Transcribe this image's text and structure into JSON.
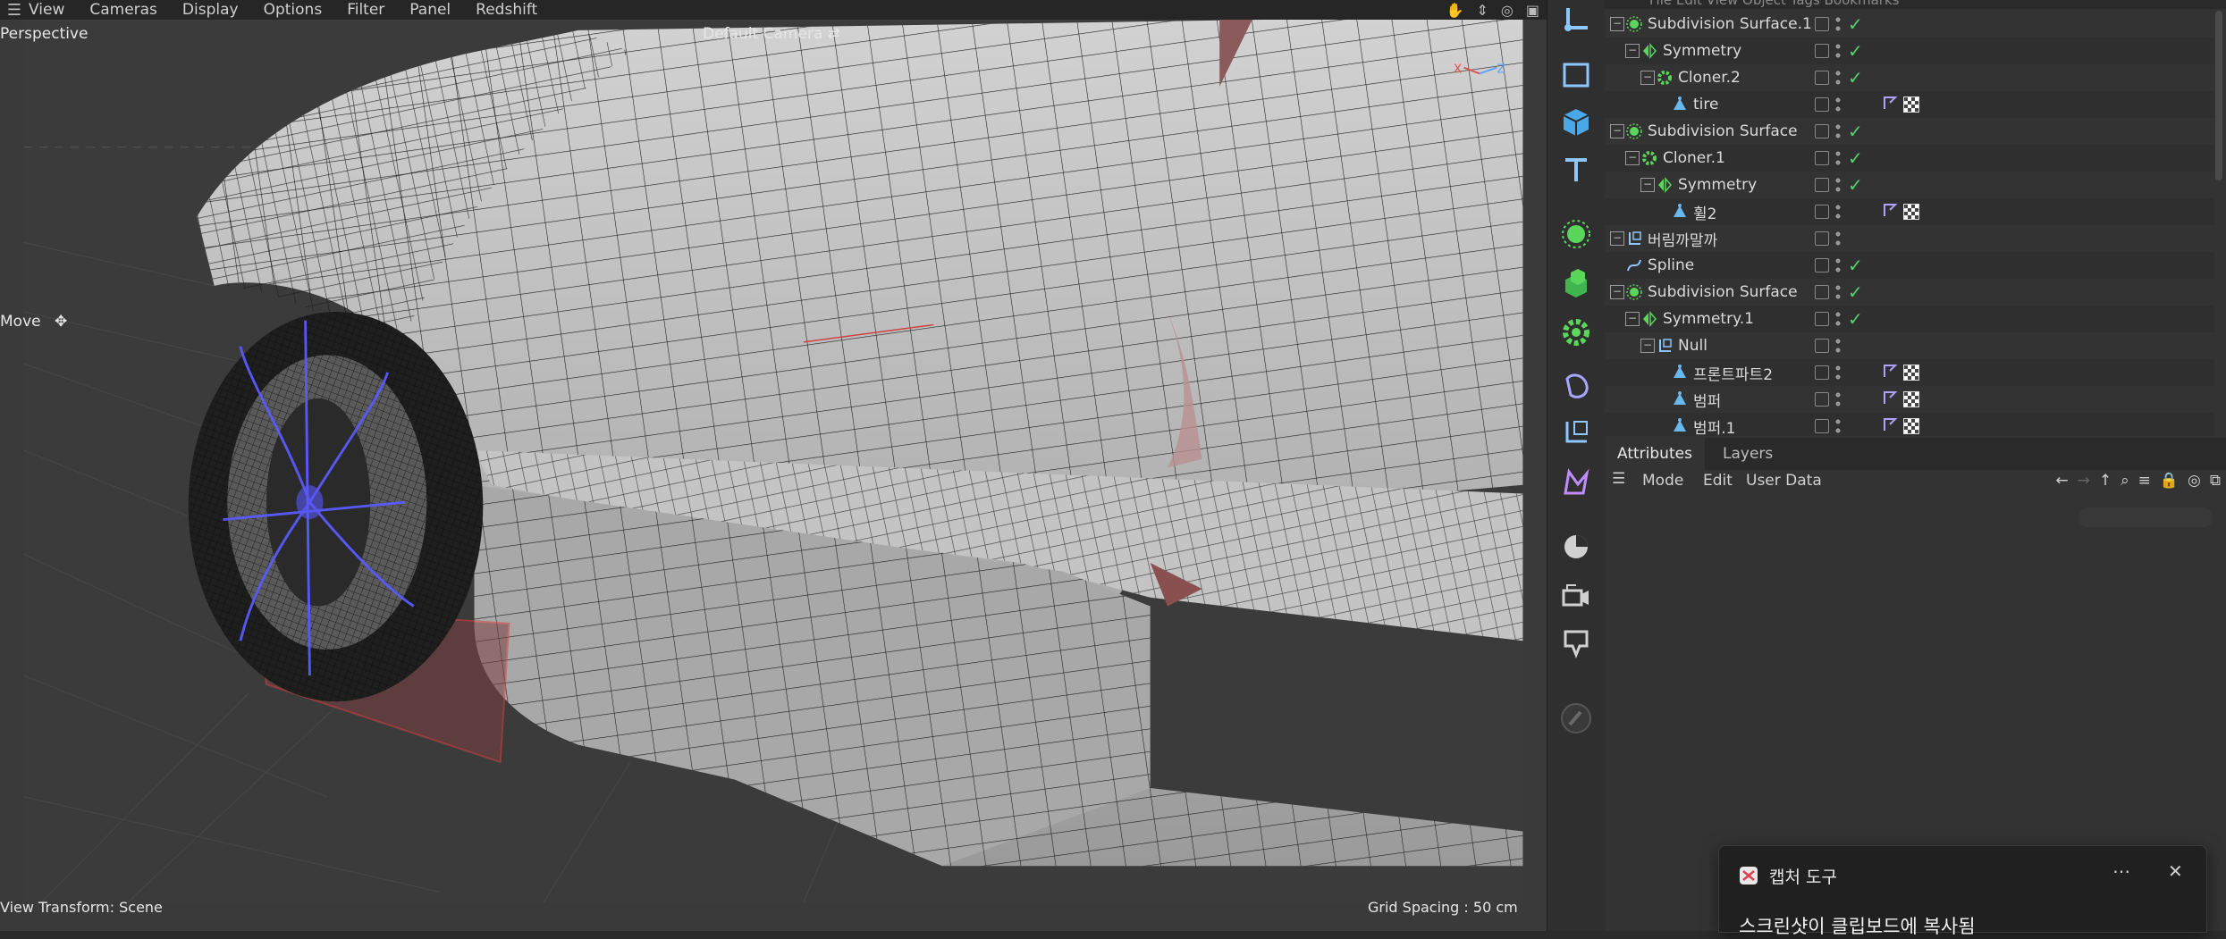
{
  "viewport": {
    "menu": [
      "View",
      "Cameras",
      "Display",
      "Options",
      "Filter",
      "Panel",
      "Redshift"
    ],
    "view_name": "Perspective",
    "camera": "Default Camera",
    "tool_label": "Move",
    "status_left": "View Transform: Scene",
    "status_right": "Grid Spacing : 50 cm"
  },
  "object_manager": {
    "menu_partial": "File   Edit   View   Object   Tags   Bookmarks",
    "items": [
      {
        "label": "Subdivision Surface.1",
        "icon": "subdivision-icon",
        "checked": true,
        "tags": false
      },
      {
        "label": "Symmetry",
        "icon": "symmetry-icon",
        "checked": true,
        "tags": false
      },
      {
        "label": "Cloner.2",
        "icon": "cloner-icon",
        "checked": true,
        "tags": false
      },
      {
        "label": "tire",
        "icon": "polygon-icon",
        "checked": false,
        "tags": true
      },
      {
        "label": "Subdivision Surface",
        "icon": "subdivision-icon",
        "checked": true,
        "tags": false
      },
      {
        "label": "Cloner.1",
        "icon": "cloner-icon",
        "checked": true,
        "tags": false
      },
      {
        "label": "Symmetry",
        "icon": "symmetry-icon",
        "checked": true,
        "tags": false
      },
      {
        "label": "휠2",
        "icon": "polygon-icon",
        "checked": false,
        "tags": true
      },
      {
        "label": "버림까말까",
        "icon": "null-icon",
        "checked": false,
        "tags": false
      },
      {
        "label": "Spline",
        "icon": "spline-icon",
        "checked": true,
        "tags": false
      },
      {
        "label": "Subdivision Surface",
        "icon": "subdivision-icon",
        "checked": true,
        "tags": false
      },
      {
        "label": "Symmetry.1",
        "icon": "symmetry-icon",
        "checked": true,
        "tags": false
      },
      {
        "label": "Null",
        "icon": "null-icon",
        "checked": false,
        "tags": false
      },
      {
        "label": "프론트파트2",
        "icon": "polygon-icon",
        "checked": false,
        "tags": true
      },
      {
        "label": "범퍼",
        "icon": "polygon-icon",
        "checked": false,
        "tags": true
      },
      {
        "label": "범퍼.1",
        "icon": "polygon-icon",
        "checked": false,
        "tags": true
      }
    ]
  },
  "attributes": {
    "tabs": [
      "Attributes",
      "Layers"
    ],
    "menu": [
      "Mode",
      "Edit",
      "User Data"
    ]
  },
  "toast": {
    "app_name": "캡처 도구",
    "message": "스크린샷이 클립보드에 복사됨"
  },
  "colors": {
    "accent_green": "#4cd66a",
    "selection_blue": "#5a5aff",
    "tag_yellow": "#e0c040"
  }
}
